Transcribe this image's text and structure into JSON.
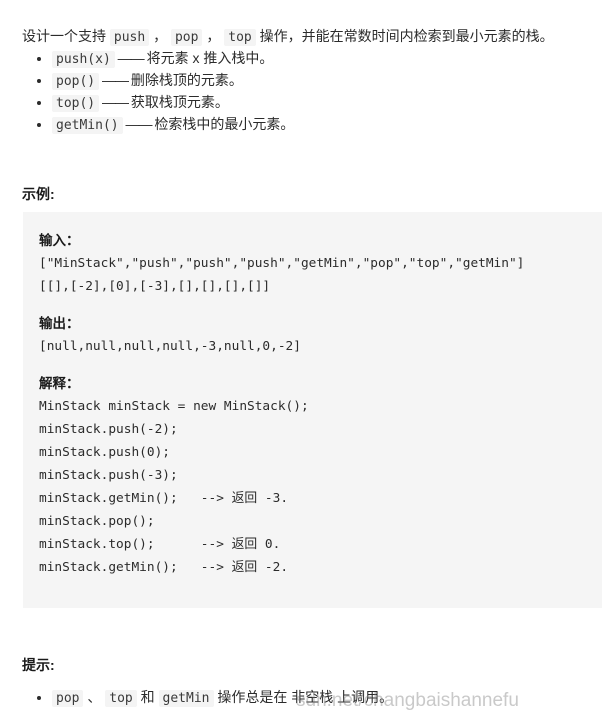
{
  "intro": {
    "before": "设计一个支持 ",
    "code1": "push",
    "sep1": " ， ",
    "code2": "pop",
    "sep2": " ， ",
    "code3": "top",
    "after": " 操作，并能在常数时间内检索到最小元素的栈。"
  },
  "operations": [
    {
      "code": "push(x)",
      "dash": " —— ",
      "text": "将元素 x 推入栈中。"
    },
    {
      "code": "pop()",
      "dash": " —— ",
      "text": "删除栈顶的元素。"
    },
    {
      "code": "top()",
      "dash": " —— ",
      "text": "获取栈顶元素。"
    },
    {
      "code": "getMin()",
      "dash": " —— ",
      "text": "检索栈中的最小元素。"
    }
  ],
  "example": {
    "heading": "示例:",
    "input_label": "输入：",
    "input_lines": [
      "[\"MinStack\",\"push\",\"push\",\"push\",\"getMin\",\"pop\",\"top\",\"getMin\"]",
      "[[],[-2],[0],[-3],[],[],[],[]]"
    ],
    "output_label": "输出：",
    "output_lines": [
      "[null,null,null,null,-3,null,0,-2]"
    ],
    "explain_label": "解释：",
    "explain_lines": [
      "MinStack minStack = new MinStack();",
      "minStack.push(-2);",
      "minStack.push(0);",
      "minStack.push(-3);",
      "minStack.getMin();   --> 返回 -3.",
      "minStack.pop();",
      "minStack.top();      --> 返回 0.",
      "minStack.getMin();   --> 返回 -2."
    ]
  },
  "hints": {
    "heading": "提示:",
    "items": [
      {
        "code1": "pop",
        "sep1": " 、 ",
        "code2": "top",
        "sep2": " 和 ",
        "code3": "getMin",
        "text": " 操作总是在 非空栈 上调用。"
      }
    ]
  },
  "watermark": {
    "text": "sdn.net/changbaishannefu"
  },
  "colors": {
    "page_background": "#ffffff",
    "code_block_background": "#f5f5f5",
    "inline_code_background": "#f4f4f4",
    "text": "#2b2b2b",
    "heading": "#1a1a1a"
  }
}
